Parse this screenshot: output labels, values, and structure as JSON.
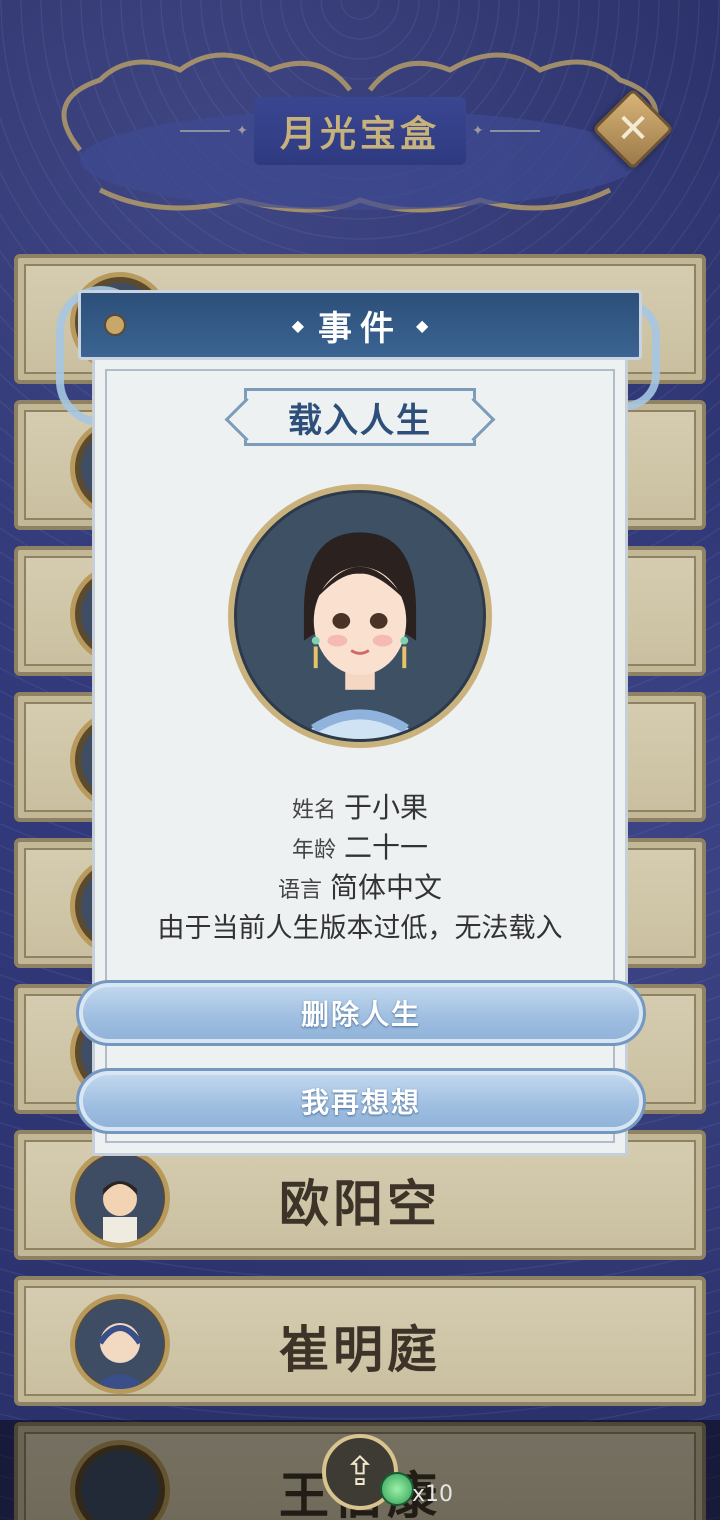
{
  "header": {
    "title": "月光宝盒",
    "close_icon": "close-icon"
  },
  "cards": [
    {
      "name": ""
    },
    {
      "name": ""
    },
    {
      "name": ""
    },
    {
      "name": ""
    },
    {
      "name": ""
    },
    {
      "name": ""
    },
    {
      "name": "欧阳空"
    },
    {
      "name": "崔明庭"
    },
    {
      "name": "王伯康"
    }
  ],
  "modal": {
    "header_title": "事件",
    "tag": "载入人生",
    "name_label": "姓名",
    "name_value": "于小果",
    "age_label": "年龄",
    "age_value": "二十一",
    "language_label": "语言",
    "language_value": "简体中文",
    "warning": "由于当前人生版本过低，无法载入",
    "delete_button": "删除人生",
    "reconsider_button": "我再想想"
  },
  "bottom": {
    "coin_count": "x10",
    "share_icon": "share-icon",
    "coin_icon": "jade-coin-icon"
  },
  "colors": {
    "background": "#2c3270",
    "modal_header": "#2d4f7a",
    "button": "#9dbde0",
    "card": "#d6cdb2",
    "title": "#c8b27c"
  }
}
